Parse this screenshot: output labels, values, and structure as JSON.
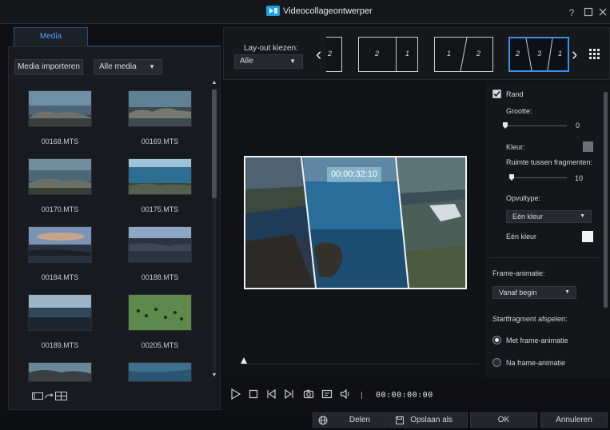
{
  "window": {
    "title": "Videocollageontwerper",
    "help_label": "?"
  },
  "media_panel": {
    "tab_label": "Media",
    "import_label": "Media importeren",
    "filter_value": "Alle media",
    "items": [
      {
        "name": "00168.MTS"
      },
      {
        "name": "00169.MTS"
      },
      {
        "name": "00170.MTS"
      },
      {
        "name": "00175.MTS"
      },
      {
        "name": "00184.MTS"
      },
      {
        "name": "00188.MTS"
      },
      {
        "name": "00189.MTS"
      },
      {
        "name": "00205.MTS"
      }
    ]
  },
  "layout_bar": {
    "label": "Lay-out kiezen:",
    "select_value": "Alle",
    "layouts": [
      {
        "nums": [
          "2"
        ]
      },
      {
        "nums": [
          "2",
          "1"
        ]
      },
      {
        "nums": [
          "1",
          "2"
        ]
      },
      {
        "nums": [
          "2",
          "3",
          "1"
        ],
        "selected": true
      }
    ]
  },
  "preview": {
    "timecode": "00:00:32:10"
  },
  "transport": {
    "time": "00:00:00:00"
  },
  "settings": {
    "border_label": "Rand",
    "border_checked": true,
    "size_label": "Grootte:",
    "size_value": "0",
    "color_label": "Kleur:",
    "color_value": "#6d7075",
    "spacing_label": "Ruimte tussen fragmenten:",
    "spacing_value": "10",
    "fill_type_label": "Opvultype:",
    "fill_type_value": "Eén kleur",
    "single_color_label": "Eén kleur",
    "single_color_value": "#f2f2f2",
    "frame_anim_label": "Frame-animatie:",
    "frame_anim_value": "Vanaf begin",
    "start_label": "Startfragment afspelen:",
    "radio_with": "Met frame-animatie",
    "radio_after": "Na frame-animatie",
    "radio_selected": "with"
  },
  "bottom_bar": {
    "share_label": "Delen",
    "save_as_label": "Opslaan als",
    "ok_label": "OK",
    "cancel_label": "Annuleren"
  },
  "colors": {
    "accent": "#3d8ef0",
    "tab_text": "#4ea1ff"
  }
}
